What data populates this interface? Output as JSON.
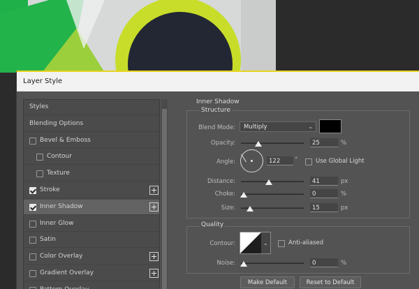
{
  "dialog": {
    "title": "Layer Style"
  },
  "styles_list": [
    {
      "label": "Styles",
      "type": "header",
      "checked": false,
      "selected": false,
      "plus": false
    },
    {
      "label": "Blending Options",
      "type": "header",
      "checked": false,
      "selected": false,
      "plus": false
    },
    {
      "label": "Bevel & Emboss",
      "type": "item",
      "checked": false,
      "selected": false,
      "plus": false
    },
    {
      "label": "Contour",
      "type": "sub",
      "checked": false,
      "selected": false,
      "plus": false
    },
    {
      "label": "Texture",
      "type": "sub",
      "checked": false,
      "selected": false,
      "plus": false
    },
    {
      "label": "Stroke",
      "type": "item",
      "checked": true,
      "selected": false,
      "plus": true
    },
    {
      "label": "Inner Shadow",
      "type": "item",
      "checked": true,
      "selected": true,
      "plus": true
    },
    {
      "label": "Inner Glow",
      "type": "item",
      "checked": false,
      "selected": false,
      "plus": false
    },
    {
      "label": "Satin",
      "type": "item",
      "checked": false,
      "selected": false,
      "plus": false
    },
    {
      "label": "Color Overlay",
      "type": "item",
      "checked": false,
      "selected": false,
      "plus": true
    },
    {
      "label": "Gradient Overlay",
      "type": "item",
      "checked": false,
      "selected": false,
      "plus": true
    },
    {
      "label": "Pattern Overlay",
      "type": "item",
      "checked": false,
      "selected": false,
      "plus": false
    }
  ],
  "inner_shadow": {
    "title": "Inner Shadow",
    "structure": {
      "title": "Structure",
      "blend_mode_label": "Blend Mode:",
      "blend_mode_value": "Multiply",
      "shadow_color": "#000000",
      "opacity_label": "Opacity:",
      "opacity_value": "25",
      "opacity_unit": "%",
      "opacity_level": 0.25,
      "angle_label": "Angle:",
      "angle_value": "122",
      "angle_unit": "°",
      "global_light_label": "Use Global Light",
      "global_light_checked": false,
      "distance_label": "Distance:",
      "distance_value": "41",
      "distance_unit": "px",
      "distance_level": 0.41,
      "choke_label": "Choke:",
      "choke_value": "0",
      "choke_unit": "%",
      "choke_level": 0,
      "size_label": "Size:",
      "size_value": "15",
      "size_unit": "px",
      "size_level": 0.06
    },
    "quality": {
      "title": "Quality",
      "contour_label": "Contour:",
      "anti_aliased_label": "Anti-aliased",
      "anti_aliased_checked": false,
      "noise_label": "Noise:",
      "noise_value": "0",
      "noise_unit": "%",
      "noise_level": 0
    },
    "buttons": {
      "make_default": "Make Default",
      "reset_default": "Reset to Default"
    }
  },
  "colors": {
    "accent": "#e8d31e",
    "panel": "#535353",
    "list": "#4b4b4b"
  }
}
